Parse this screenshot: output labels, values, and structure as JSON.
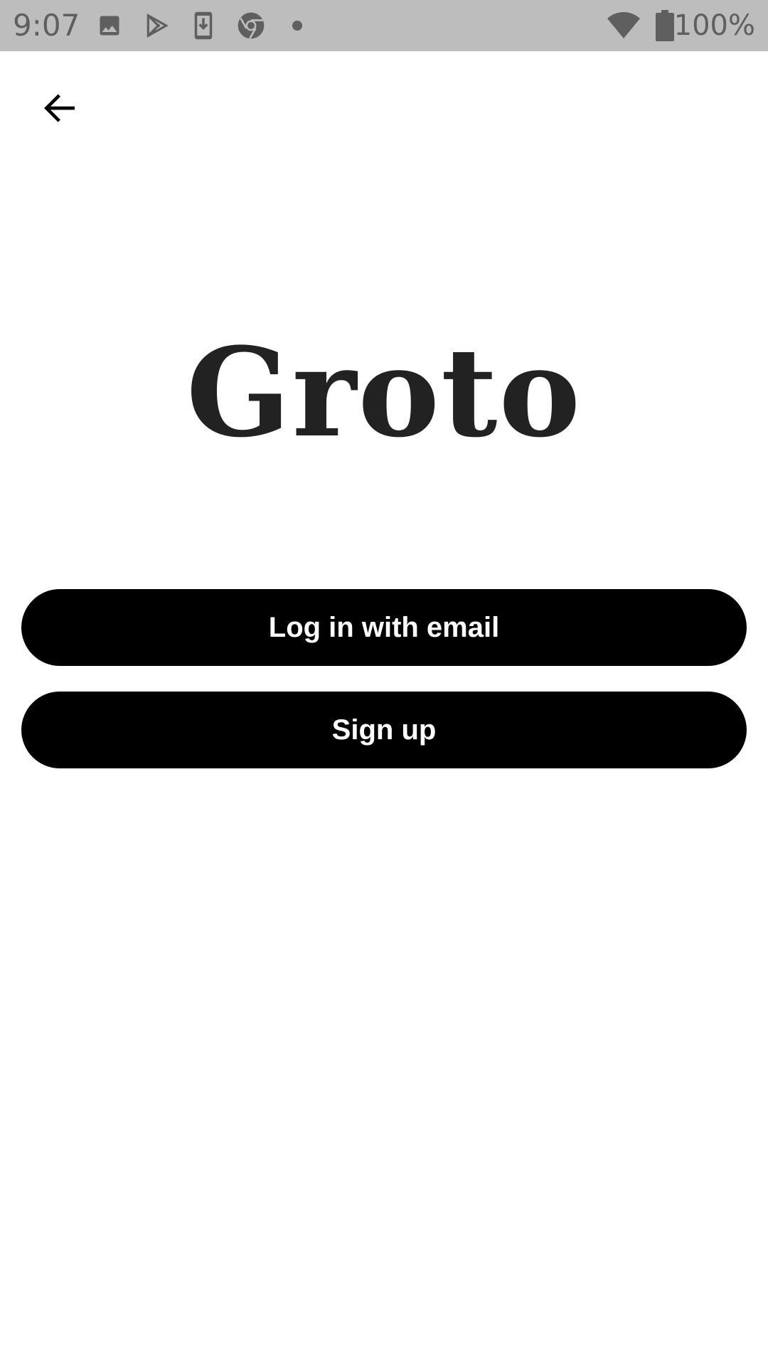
{
  "status_bar": {
    "time": "9:07",
    "battery_text": "100%",
    "background_color": "#bdbdbd",
    "icon_color": "#5f5f5f",
    "notification_icons": [
      "image-icon",
      "play-store-icon",
      "download-icon",
      "chrome-icon",
      "dot-icon"
    ],
    "system_icons": [
      "wifi-icon",
      "battery-icon"
    ]
  },
  "nav": {
    "back_icon": "arrow-left-icon"
  },
  "logo": {
    "text": "Groto",
    "color": "#222222"
  },
  "actions": {
    "login_label": "Log in with email",
    "signup_label": "Sign up",
    "button_color": "#000000",
    "button_text_color": "#ffffff"
  }
}
